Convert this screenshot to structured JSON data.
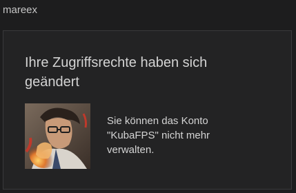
{
  "header": {
    "username": "mareex"
  },
  "card": {
    "title": "Ihre Zugriffsrechte haben sich geändert",
    "message": "Sie können das Konto \"KubaFPS\" nicht mehr verwalten.",
    "avatar_icon": "account-avatar-image"
  },
  "colors": {
    "background": "#1d1d1e",
    "card_background": "#232324",
    "card_border": "#3a3a3c",
    "text": "#d4d4d4"
  }
}
